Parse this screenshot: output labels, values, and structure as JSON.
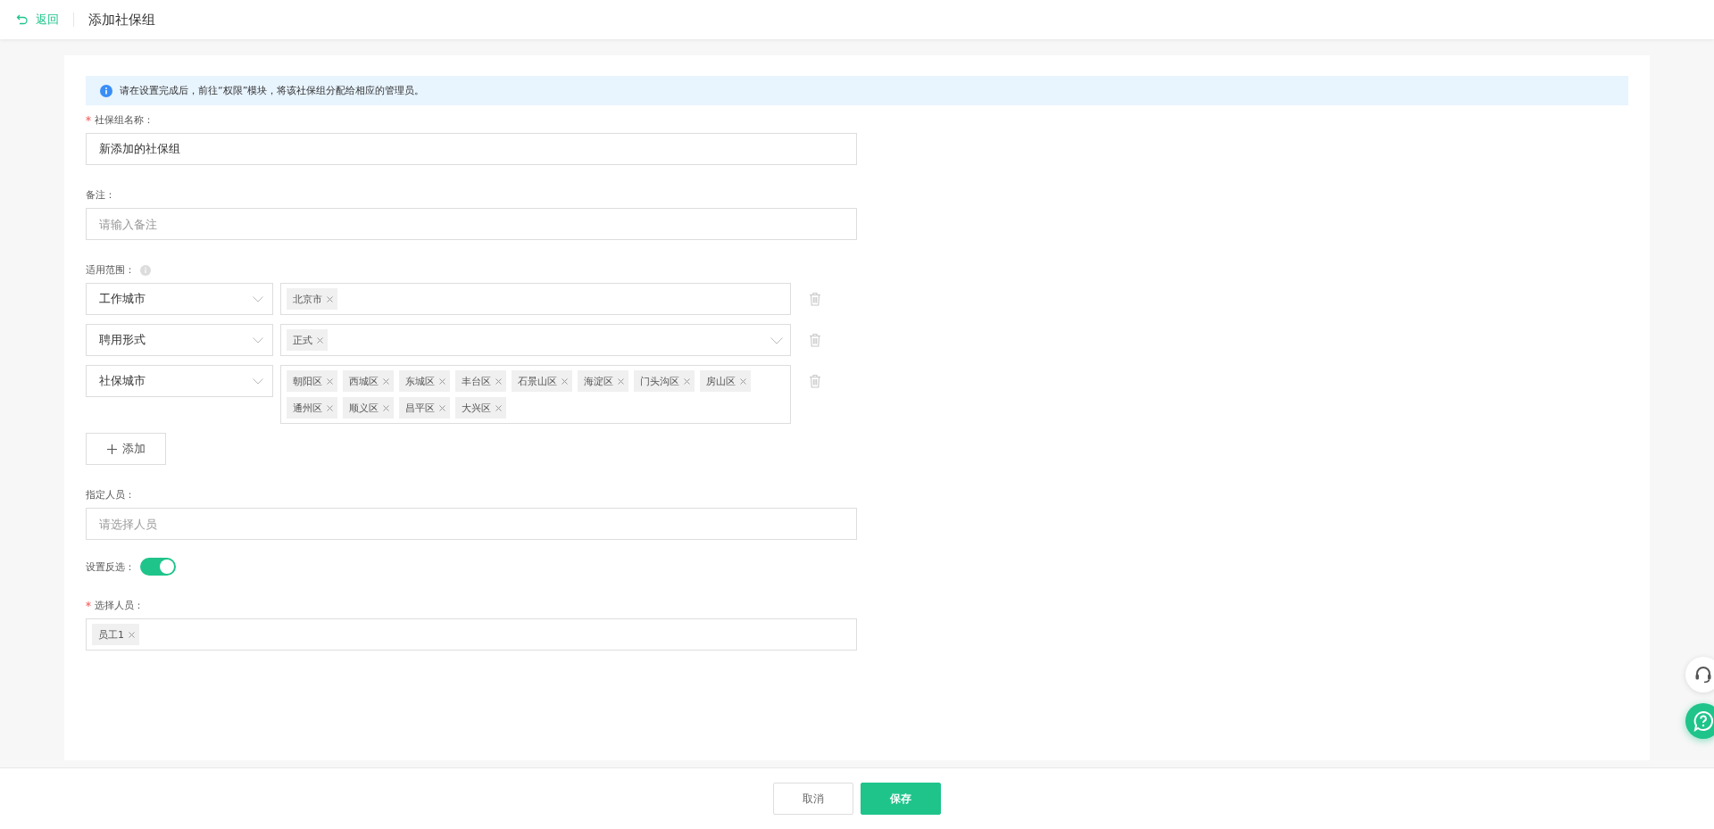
{
  "header": {
    "back": "返回",
    "title": "添加社保组"
  },
  "notice": "请在设置完成后，前往“权限”模块，将该社保组分配给相应的管理员。",
  "name_field": {
    "label": "社保组名称：",
    "required": true,
    "value": "新添加的社保组"
  },
  "remark_field": {
    "label": "备注：",
    "required": false,
    "placeholder": "请输入备注"
  },
  "scope": {
    "label": "适用范围：",
    "rows": [
      {
        "condition": "工作城市",
        "dropdown": false,
        "tags": [
          "北京市"
        ]
      },
      {
        "condition": "聘用形式",
        "dropdown": true,
        "tags": [
          "正式"
        ]
      },
      {
        "condition": "社保城市",
        "dropdown": false,
        "tags": [
          "朝阳区",
          "西城区",
          "东城区",
          "丰台区",
          "石景山区",
          "海淀区",
          "门头沟区",
          "房山区",
          "通州区",
          "顺义区",
          "昌平区",
          "大兴区"
        ]
      }
    ],
    "add_button": "添加"
  },
  "assign_field": {
    "label": "指定人员：",
    "required": false,
    "placeholder": "请选择人员"
  },
  "invert": {
    "label": "设置反选：",
    "on": true
  },
  "select_field": {
    "label": "选择人员：",
    "required": true,
    "tags": [
      "员工1"
    ]
  },
  "footer": {
    "cancel": "取消",
    "save": "保存"
  }
}
